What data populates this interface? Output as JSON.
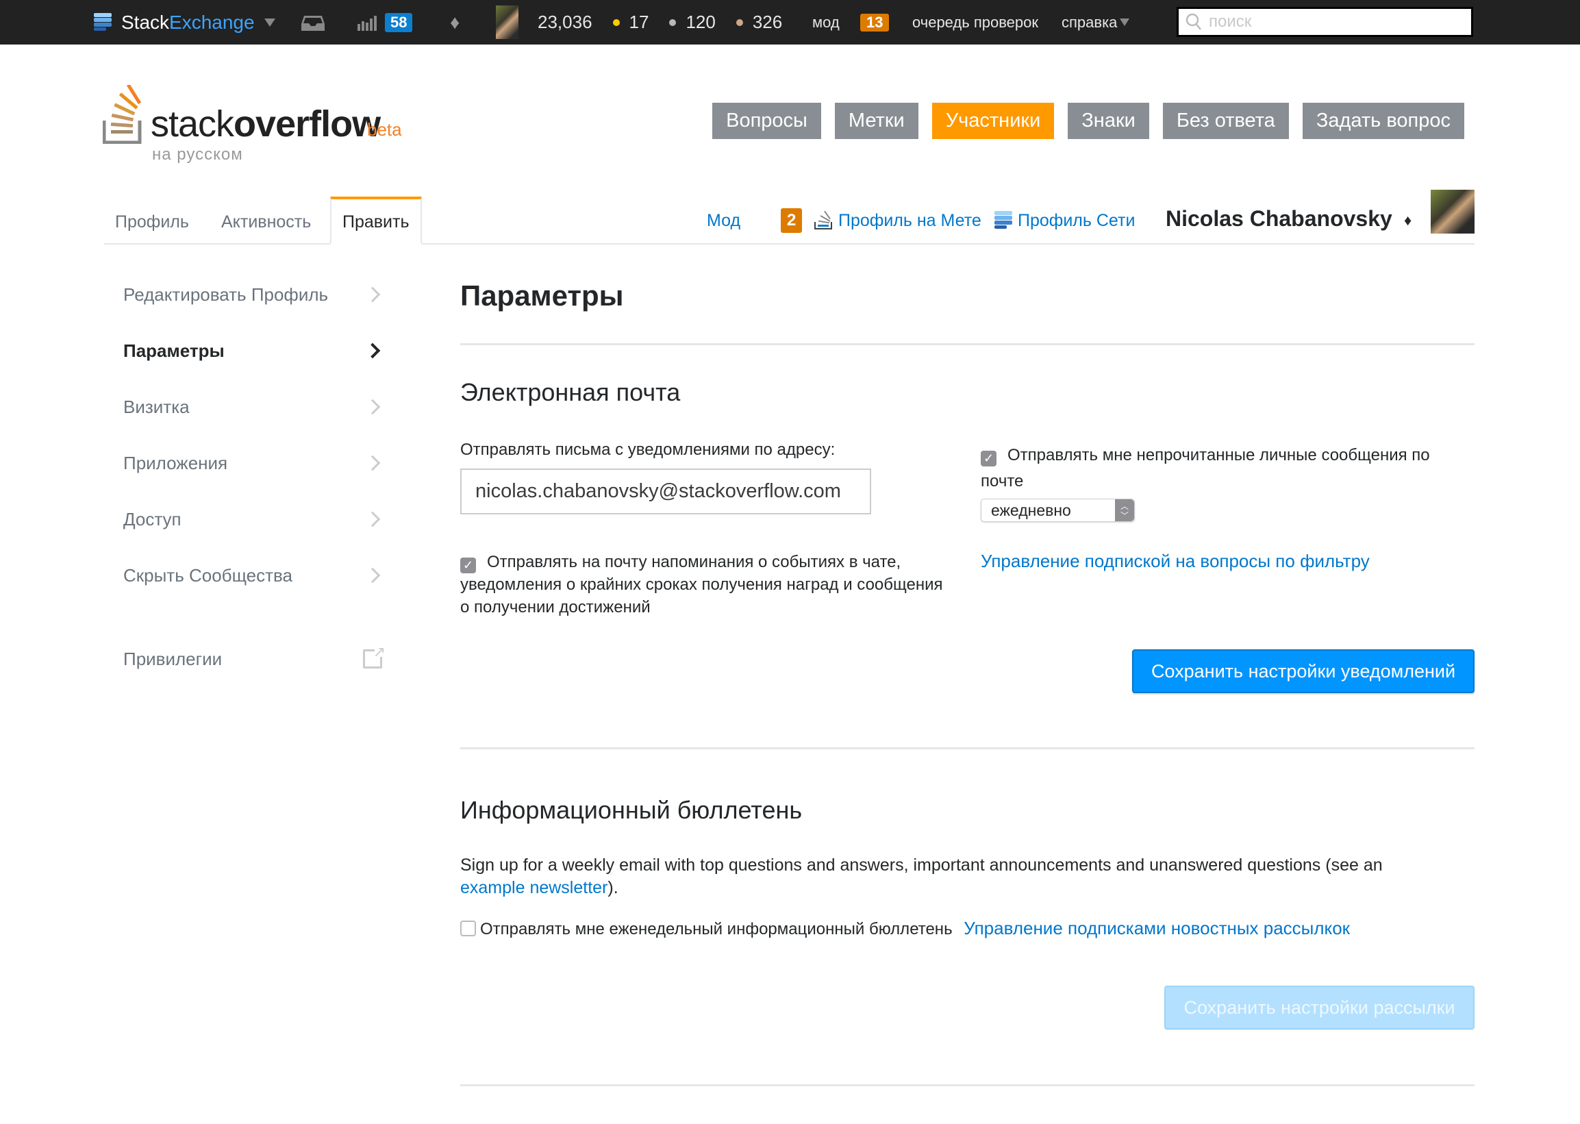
{
  "topbar": {
    "brand_stack": "Stack",
    "brand_exchange": "Exchange",
    "achievements_badge": "58",
    "reputation": "23,036",
    "badges": {
      "gold": "17",
      "silver": "120",
      "bronze": "326"
    },
    "badge_colors": {
      "gold": "#ffcc01",
      "silver": "#b4b8bc",
      "bronze": "#d1a684"
    },
    "mod_label": "мод",
    "mod_flags": "13",
    "review_label": "очередь проверок",
    "help_label": "справка",
    "search_placeholder": "поиск"
  },
  "header": {
    "logo_light": "stack",
    "logo_bold": "overflow",
    "logo_beta": "beta",
    "logo_sub": "на русском",
    "nav": [
      {
        "label": "Вопросы",
        "active": false
      },
      {
        "label": "Метки",
        "active": false
      },
      {
        "label": "Участники",
        "active": true
      },
      {
        "label": "Знаки",
        "active": false
      },
      {
        "label": "Без ответа",
        "active": false
      },
      {
        "label": "Задать вопрос",
        "active": false
      }
    ]
  },
  "tabs": {
    "items": [
      {
        "label": "Профиль"
      },
      {
        "label": "Активность"
      },
      {
        "label": "Править",
        "active": true
      }
    ],
    "mod_link": "Мод",
    "mod_count": "2",
    "meta_profile": "Профиль на Мете",
    "network_profile": "Профиль Сети",
    "user_name": "Nicolas Chabanovsky",
    "user_diamond": "♦"
  },
  "sidebar": {
    "items": [
      {
        "label": "Редактировать Профиль"
      },
      {
        "label": "Параметры",
        "active": true
      },
      {
        "label": "Визитка"
      },
      {
        "label": "Приложения"
      },
      {
        "label": "Доступ"
      },
      {
        "label": "Скрыть Сообщества"
      },
      {
        "label": "Привилегии",
        "external": true
      }
    ]
  },
  "main": {
    "title": "Параметры",
    "email_section": {
      "heading": "Электронная почта",
      "address_label": "Отправлять письма с уведомлениями по адресу:",
      "email_value": "nicolas.chabanovsky@stackoverflow.com",
      "chat_checkbox_checked": true,
      "chat_checkbox_label_1": "Отправлять на почту напоминания о событиях в чате,",
      "chat_checkbox_label_2": "уведомления о крайних сроках получения наград и сообщения",
      "chat_checkbox_label_3": "о получении достижений",
      "pm_checkbox_checked": true,
      "pm_checkbox_label_1": "Отправлять мне непрочитанные личные сообщения по",
      "pm_checkbox_label_2": "почте",
      "frequency_value": "ежедневно",
      "filter_link": "Управление подпиской на вопросы по фильтру",
      "save_button": "Сохранить настройки уведомлений"
    },
    "newsletter_section": {
      "heading": "Информационный бюллетень",
      "description": "Sign up for a weekly email with top questions and answers, important announcements and unanswered questions (see an",
      "example_link": "example newsletter",
      "description_end": ").",
      "weekly_checkbox_checked": false,
      "weekly_checkbox_label": "Отправлять мне еженедельный информационный бюллетень",
      "manage_link": "Управление подписками новостных рассылкок",
      "save_button": "Сохранить настройки рассылки"
    }
  },
  "colors": {
    "accent_orange": "#ff9900",
    "nav_gray": "#888e93",
    "link_blue": "#0077cc",
    "primary_button": "#0095ff",
    "topbar_bg": "#222222"
  }
}
